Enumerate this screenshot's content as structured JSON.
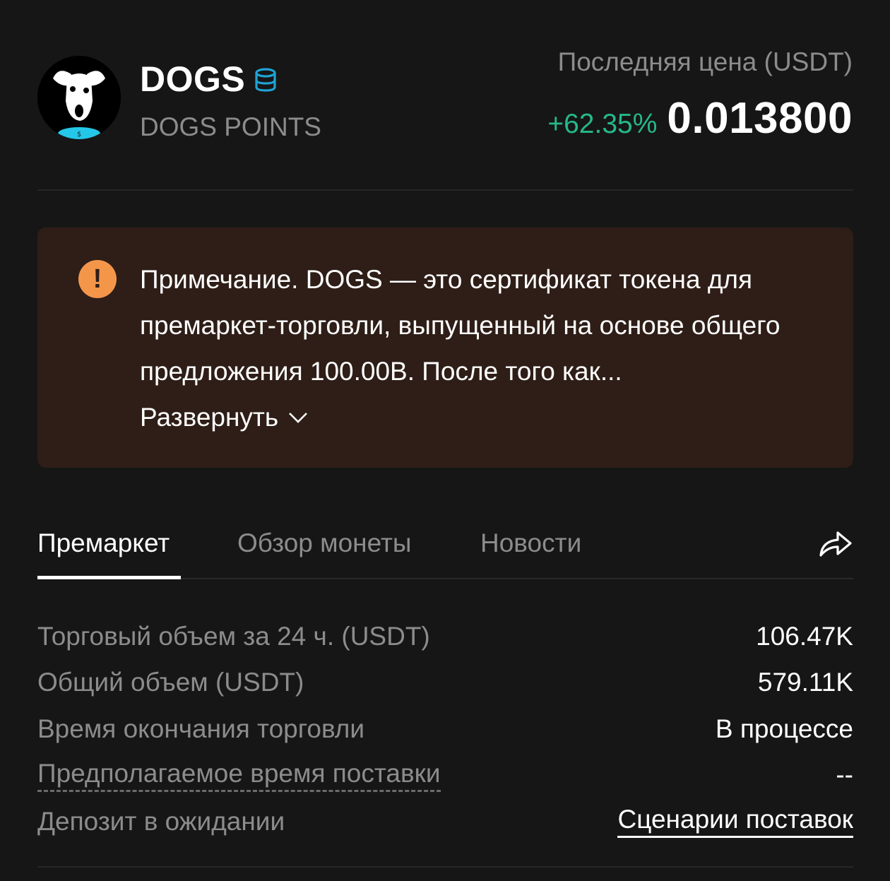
{
  "coin": {
    "symbol": "DOGS",
    "name": "DOGS POINTS",
    "icon": "database-icon"
  },
  "price": {
    "label": "Последняя цена (USDT)",
    "change": "+62.35%",
    "value": "0.013800"
  },
  "notice": {
    "icon": "warning-icon",
    "text": "Примечание. DOGS — это сертификат токена для премаркет-торговли, выпущенный на основе общего предложения 100.00B. После того как...",
    "expand_label": "Развернуть"
  },
  "tabs": [
    {
      "label": "Премаркет",
      "active": true
    },
    {
      "label": "Обзор монеты",
      "active": false
    },
    {
      "label": "Новости",
      "active": false
    }
  ],
  "stats": [
    {
      "label": "Торговый объем за 24 ч. (USDT)",
      "value": "106.47K"
    },
    {
      "label": "Общий объем (USDT)",
      "value": "579.11K"
    },
    {
      "label": "Время окончания торговли",
      "value": "В процессе"
    },
    {
      "label": "Предполагаемое время поставки",
      "value": "--"
    },
    {
      "label": "Депозит в ожидании",
      "value": "Сценарии поставок"
    }
  ],
  "colors": {
    "background": "#161616",
    "positive": "#25b98a",
    "muted": "#8c8c8c",
    "notice_bg": "#2e1e17",
    "warning": "#f4964a",
    "accent": "#1fa3d6"
  }
}
